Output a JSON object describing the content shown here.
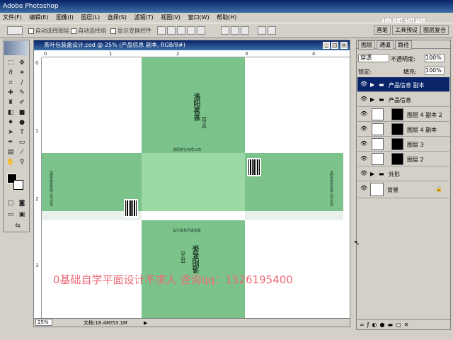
{
  "app": {
    "title": "Adobe Photoshop"
  },
  "menu": [
    "文件(F)",
    "编辑(E)",
    "图像(I)",
    "图层(L)",
    "选择(S)",
    "滤镜(T)",
    "视图(V)",
    "窗口(W)",
    "帮助(H)"
  ],
  "options": {
    "auto_select_layer": "自动选择图层",
    "auto_select_group": "自动选择组",
    "show_bounds": "显示变换控件"
  },
  "top_panel": {
    "tabs": [
      "画笔",
      "工具预设",
      "图层复合"
    ]
  },
  "site_logo": "搜狐视频",
  "document": {
    "title": "茶叶包装盒设计.psd @ 25% (产品信息 副本, RGB/8#)",
    "zoom": "25%",
    "doc_size": "文档:18.4M/53.1M",
    "ruler_h": [
      "0",
      "1",
      "2",
      "3",
      "4"
    ],
    "ruler_v": [
      "0",
      "1",
      "2",
      "3"
    ]
  },
  "artwork": {
    "product_name": "洛阳茗茶",
    "product_sub": "【精品】",
    "company": "洛阳茶业有限公司",
    "side_text_1": "洛阳茗茶有限公司出品",
    "side_text_2": "洛阳茗茶有限公司出品",
    "bottom_name": "洛阳茗茶",
    "bottom_sub": "【精品】"
  },
  "watermark": "0基础自学平面设计不求人 咨询qq：1526195400",
  "layers_panel": {
    "tabs": [
      "图层",
      "通道",
      "路径"
    ],
    "blend_mode": "穿透",
    "opacity_label": "不透明度:",
    "opacity_value": "100%",
    "lock_label": "锁定:",
    "fill_label": "填充:",
    "fill_value": "100%",
    "layers": [
      {
        "name": "产品信息 副本",
        "type": "group",
        "selected": true
      },
      {
        "name": "产品信息",
        "type": "group",
        "selected": false
      },
      {
        "name": "图层 4 副本 2",
        "type": "layer",
        "selected": false
      },
      {
        "name": "图层 4 副本",
        "type": "layer",
        "selected": false
      },
      {
        "name": "图层 3",
        "type": "layer",
        "selected": false
      },
      {
        "name": "图层 2",
        "type": "layer",
        "selected": false
      },
      {
        "name": "外形",
        "type": "group",
        "selected": false
      },
      {
        "name": "背景",
        "type": "background",
        "selected": false
      }
    ]
  }
}
